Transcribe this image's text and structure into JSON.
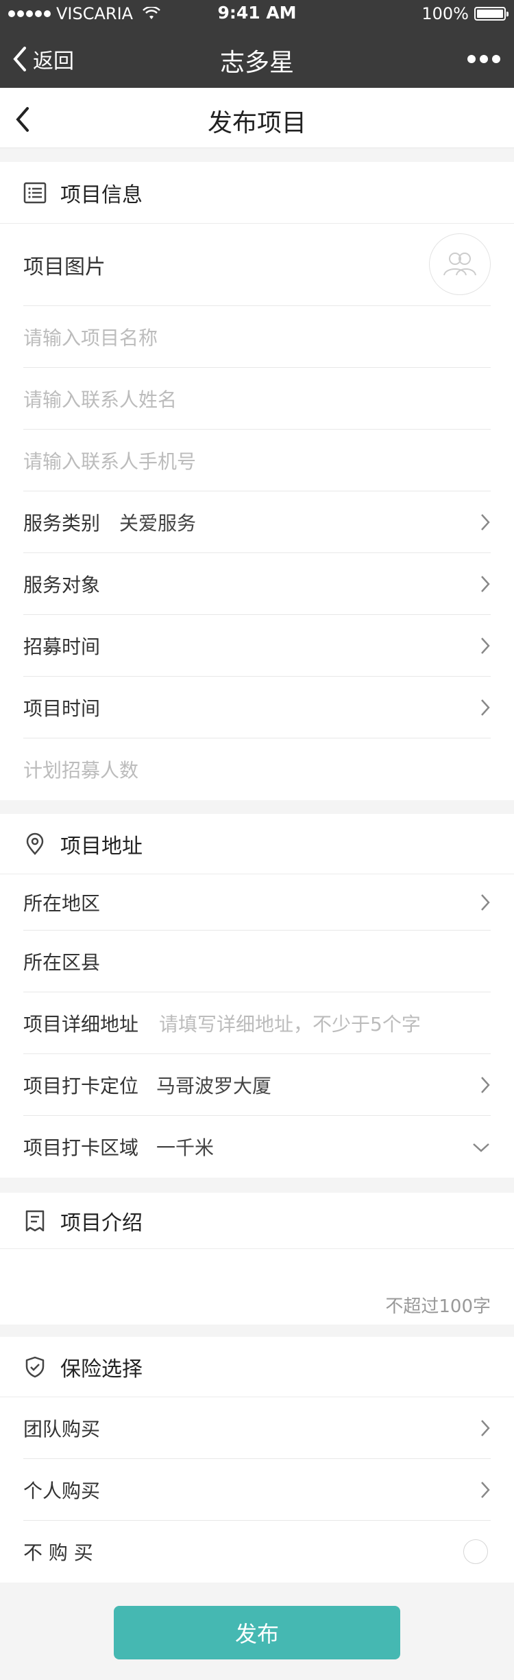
{
  "status_bar": {
    "carrier": "VISCARIA",
    "time": "9:41 AM",
    "battery": "100%"
  },
  "nav_bar": {
    "back_label": "返回",
    "title": "志多星"
  },
  "page": {
    "title": "发布项目"
  },
  "project_info": {
    "heading": "项目信息",
    "image_label": "项目图片",
    "name_placeholder": "请输入项目名称",
    "contact_name_placeholder": "请输入联系人姓名",
    "contact_phone_placeholder": "请输入联系人手机号",
    "service_type_label": "服务类别",
    "service_type_value": "关爱服务",
    "service_target_label": "服务对象",
    "recruit_time_label": "招募时间",
    "project_time_label": "项目时间",
    "plan_count_placeholder": "计划招募人数"
  },
  "project_address": {
    "heading": "项目地址",
    "region_label": "所在地区",
    "county_label": "所在区县",
    "detail_label": "项目详细地址",
    "detail_placeholder": "请填写详细地址，不少于5个字",
    "checkin_location_label": "项目打卡定位",
    "checkin_location_value": "马哥波罗大厦",
    "checkin_area_label": "项目打卡区域",
    "checkin_area_value": "一千米"
  },
  "project_intro": {
    "heading": "项目介绍",
    "limit_hint": "不超过100字"
  },
  "insurance": {
    "heading": "保险选择",
    "team_label": "团队购买",
    "personal_label": "个人购买",
    "none_label": "不 购 买"
  },
  "actions": {
    "publish_label": "发布"
  },
  "colors": {
    "nav_bg": "#3b3b3b",
    "accent": "#45b8b2",
    "placeholder": "#bcbcbc"
  }
}
